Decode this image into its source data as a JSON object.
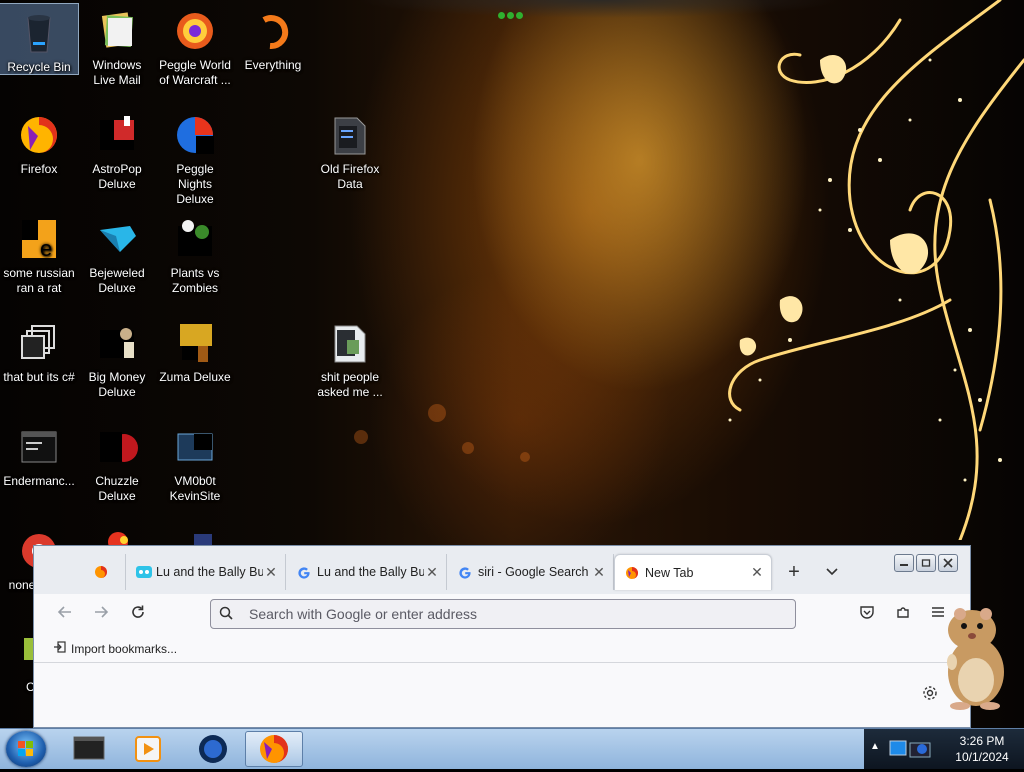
{
  "desktop": {
    "icons": [
      {
        "label": "Recycle Bin",
        "icon": "recycle-bin-icon"
      },
      {
        "label": "Windows Live Mail",
        "icon": "windows-live-mail-icon"
      },
      {
        "label": "Peggle World of Warcraft ...",
        "icon": "peggle-wow-icon"
      },
      {
        "label": "Everything",
        "icon": "everything-search-icon"
      },
      {
        "label": "Firefox",
        "icon": "firefox-icon"
      },
      {
        "label": "AstroPop Deluxe",
        "icon": "astropop-icon"
      },
      {
        "label": "Peggle Nights Deluxe",
        "icon": "peggle-nights-icon"
      },
      {
        "label": "Old Firefox Data",
        "icon": "folder-icon"
      },
      {
        "label": "some russian ran a rat",
        "icon": "java-icon"
      },
      {
        "label": "Bejeweled Deluxe",
        "icon": "bejeweled-icon"
      },
      {
        "label": "Plants vs Zombies",
        "icon": "plants-vs-zombies-icon"
      },
      {
        "label": "that but its c#",
        "icon": "shortcut-icon"
      },
      {
        "label": "Big Money Deluxe",
        "icon": "big-money-icon"
      },
      {
        "label": "Zuma Deluxe",
        "icon": "zuma-icon"
      },
      {
        "label": "shit people asked me ...",
        "icon": "folder-icon"
      },
      {
        "label": "Endermanc...",
        "icon": "terminal-icon"
      },
      {
        "label": "Chuzzle Deluxe",
        "icon": "chuzzle-icon"
      },
      {
        "label": "VM0b0t KevinSite",
        "icon": "vm-icon"
      },
      {
        "label": "none retarc",
        "icon": "chrome-icon"
      },
      {
        "label": "Chor",
        "icon": "game-icon"
      }
    ]
  },
  "browser": {
    "tabs": [
      {
        "label": "Lu and the Bally Bu",
        "favicon": "bally-favicon-icon",
        "active": false
      },
      {
        "label": "Lu and the Bally Bu",
        "favicon": "google-favicon-icon",
        "active": false
      },
      {
        "label": "siri - Google Search",
        "favicon": "google-favicon-icon",
        "active": false
      },
      {
        "label": "New Tab",
        "favicon": "firefox-favicon-icon",
        "active": true
      }
    ],
    "new_tab_glyph": "+",
    "tab_list_glyph": "⌄",
    "url_placeholder": "Search with Google or enter address",
    "bookmarks": {
      "import_label": "Import bookmarks..."
    }
  },
  "taskbar": {
    "apps": [
      "taskbar-app-icon",
      "media-player-icon",
      "vm-icon",
      "firefox-icon"
    ],
    "clock": {
      "time": "3:26 PM",
      "date": "10/1/2024"
    }
  },
  "colors": {
    "accent": "#ffb830",
    "taskbar": "#a9c6e8",
    "tab_active": "#ffffff"
  }
}
